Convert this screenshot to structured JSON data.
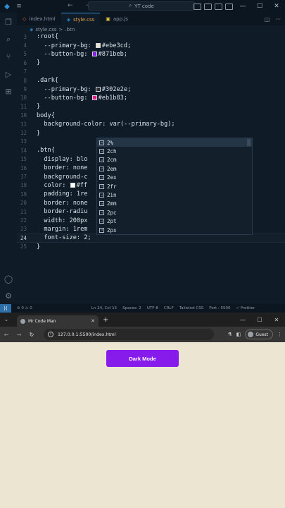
{
  "vscode": {
    "search_text": "YT code",
    "tabs": [
      {
        "name": "index.html",
        "icon": "html-file-icon"
      },
      {
        "name": "style.css",
        "icon": "css-file-icon"
      },
      {
        "name": "app.js",
        "icon": "js-file-icon"
      }
    ],
    "breadcrumb": {
      "file": "style.css",
      "sep": ">",
      "symbol": ".btn"
    },
    "lines": [
      {
        "n": "3",
        "text": ":root{"
      },
      {
        "n": "4",
        "text": "  --primary-bg: ",
        "swatch": "#ebe3cd",
        "after": "#ebe3cd;"
      },
      {
        "n": "5",
        "text": "  --button-bg: ",
        "swatch": "#871beb",
        "after": "#871beb;"
      },
      {
        "n": "6",
        "text": "}"
      },
      {
        "n": "7",
        "text": ""
      },
      {
        "n": "8",
        "text": ".dark{"
      },
      {
        "n": "9",
        "text": "  --primary-bg: ",
        "swatch": "#302e2e",
        "after": "#302e2e;"
      },
      {
        "n": "10",
        "text": "  --button-bg: ",
        "swatch": "#eb1b83",
        "after": "#eb1b83;"
      },
      {
        "n": "11",
        "text": "}"
      },
      {
        "n": "10",
        "text": "body{"
      },
      {
        "n": "11",
        "text": "  background-color: var(--primary-bg);"
      },
      {
        "n": "12",
        "text": "}"
      },
      {
        "n": "13",
        "text": ""
      },
      {
        "n": "14",
        "text": ".btn{"
      },
      {
        "n": "15",
        "text": "  display: blo"
      },
      {
        "n": "16",
        "text": "  border: none"
      },
      {
        "n": "17",
        "text": "  background-c"
      },
      {
        "n": "18",
        "text": "  color: ",
        "swatch": "#ffffff",
        "after": "#ff"
      },
      {
        "n": "19",
        "text": "  padding: 1re"
      },
      {
        "n": "20",
        "text": "  border: none"
      },
      {
        "n": "21",
        "text": "  border-radiu"
      },
      {
        "n": "22",
        "text": "  width: 200px"
      },
      {
        "n": "23",
        "text": "  margin: 1rem"
      },
      {
        "n": "24",
        "text": "  font-size: 2;",
        "current": true
      },
      {
        "n": "25",
        "text": "}"
      }
    ],
    "suggestions": [
      "2%",
      "2ch",
      "2cm",
      "2em",
      "2ex",
      "2fr",
      "2in",
      "2mm",
      "2pc",
      "2pt",
      "2px"
    ],
    "status": {
      "errors": "⊘ 0 ⚠ 0",
      "position": "Ln 24, Col 15",
      "spaces": "Spaces: 2",
      "encoding": "UTF-8",
      "eol": "CRLF",
      "language": "Tailwind CSS",
      "port": "Port : 5500",
      "prettier": "✓ Prettier"
    }
  },
  "browser": {
    "tab_title": "Mr Code Man",
    "url": "127.0.0.1:5500/index.html",
    "profile": "Guest",
    "button_label": "Dark Mode",
    "button_color": "#871beb",
    "page_bg": "#ece5d2"
  }
}
